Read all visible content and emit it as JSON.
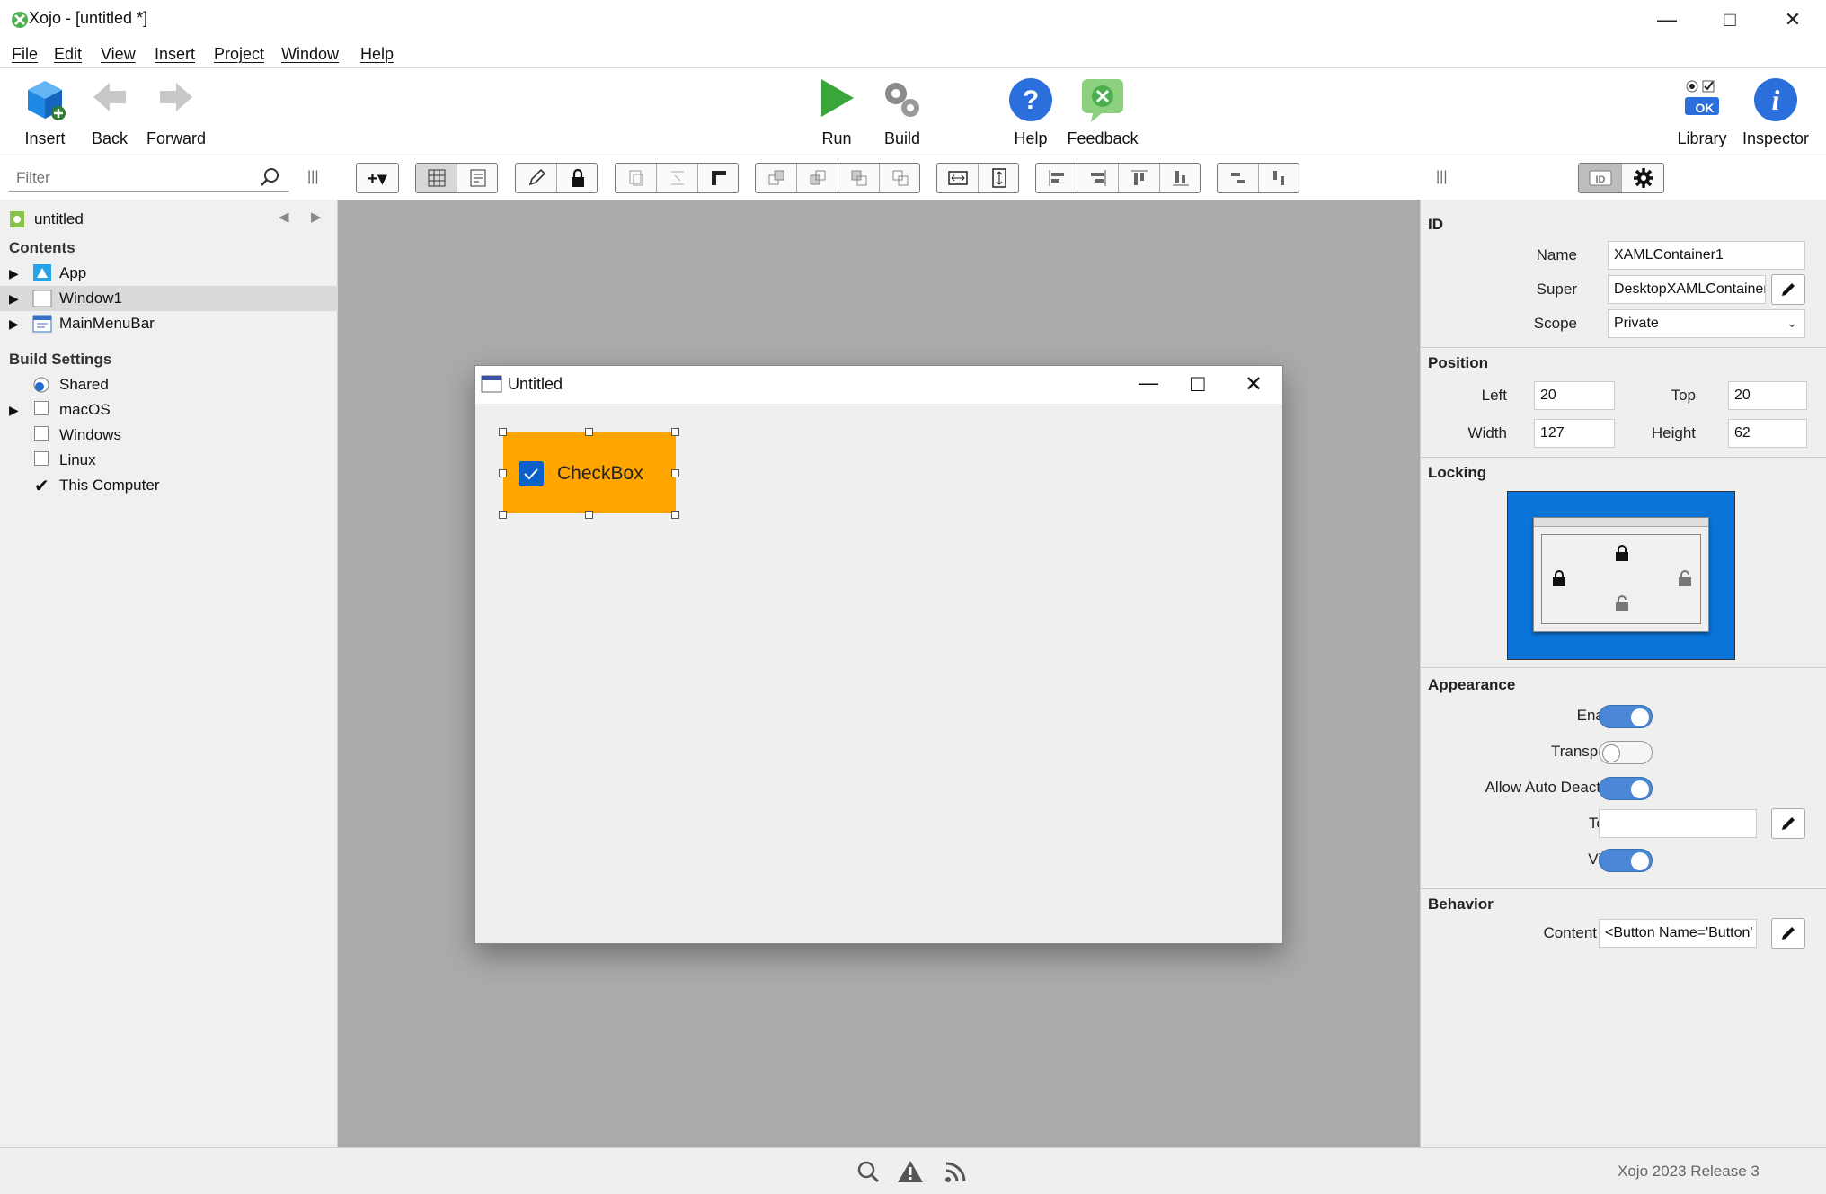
{
  "window": {
    "title": "Xojo - [untitled *]"
  },
  "menu": [
    "File",
    "Edit",
    "View",
    "Insert",
    "Project",
    "Window",
    "Help"
  ],
  "toolbar": {
    "insert": "Insert",
    "back": "Back",
    "forward": "Forward",
    "run": "Run",
    "build": "Build",
    "help": "Help",
    "feedback": "Feedback",
    "library": "Library",
    "inspector": "Inspector",
    "library_ok": "OK"
  },
  "navigator": {
    "filter_placeholder": "Filter",
    "project": "untitled",
    "contents_header": "Contents",
    "items": [
      "App",
      "Window1",
      "MainMenuBar"
    ],
    "build_header": "Build Settings",
    "build_items": [
      "Shared",
      "macOS",
      "Windows",
      "Linux",
      "This Computer"
    ]
  },
  "designer": {
    "window_title": "Untitled",
    "control_label": "CheckBox",
    "control_color": "#ffa500"
  },
  "inspector": {
    "id_header": "ID",
    "name_label": "Name",
    "name_value": "XAMLContainer1",
    "super_label": "Super",
    "super_value": "DesktopXAMLContainer",
    "scope_label": "Scope",
    "scope_value": "Private",
    "position_header": "Position",
    "left_label": "Left",
    "left_value": "20",
    "top_label": "Top",
    "top_value": "20",
    "width_label": "Width",
    "width_value": "127",
    "height_label": "Height",
    "height_value": "62",
    "locking_header": "Locking",
    "appearance_header": "Appearance",
    "enabled_label": "Enabled",
    "enabled": true,
    "transparent_label": "Transparent",
    "transparent": false,
    "autodeactivate_label": "Allow Auto Deactivate",
    "autodeactivate": true,
    "tooltip_label": "Tooltip",
    "tooltip_value": "",
    "visible_label": "Visible",
    "visible": true,
    "behavior_header": "Behavior",
    "content_label": "Content",
    "content_value": "<Button Name='Button'"
  },
  "status": {
    "version": "Xojo 2023 Release 3"
  },
  "colors": {
    "accent": "#0a74d9",
    "selection": "#ffa500",
    "run_green": "#3aa53a"
  }
}
